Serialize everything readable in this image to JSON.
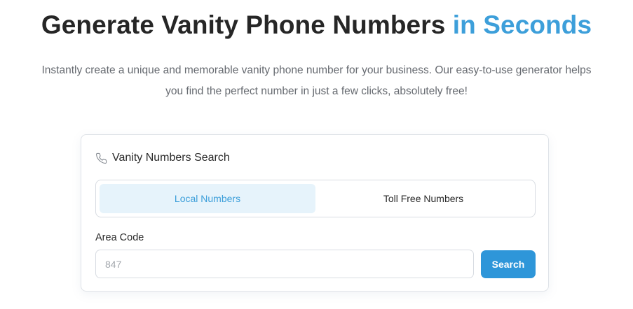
{
  "hero": {
    "title_main": "Generate Vanity Phone Numbers ",
    "title_accent": "in Seconds",
    "subtitle_line1": "Instantly create a unique and memorable vanity phone number for your business. Our easy-to-use generator helps",
    "subtitle_line2": "you find the perfect number in just a few clicks, absolutely free!"
  },
  "card": {
    "icon": "phone-icon",
    "title": "Vanity Numbers Search",
    "tabs": [
      {
        "label": "Local Numbers",
        "active": true
      },
      {
        "label": "Toll Free Numbers",
        "active": false
      }
    ],
    "area_code_label": "Area Code",
    "area_code_placeholder": "847",
    "area_code_value": "",
    "search_label": "Search"
  },
  "colors": {
    "accent": "#3d9fda",
    "button": "#2e96d9",
    "active_tab_bg": "#e6f3fb",
    "heading": "#262626",
    "subtext": "#666a70"
  }
}
